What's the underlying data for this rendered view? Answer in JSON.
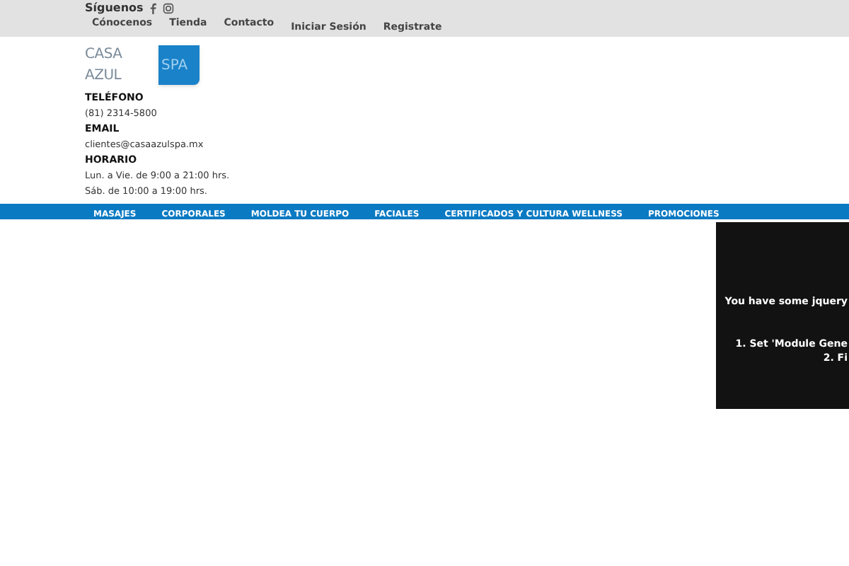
{
  "top_bar": {
    "follow_label": "Síguenos",
    "links": [
      "Cónocenos",
      "Tienda",
      "Contacto"
    ],
    "account_links": [
      "Iniciar Sesión",
      "Registrate"
    ]
  },
  "logo": {
    "name": "CASA AZUL",
    "badge": "SPA"
  },
  "contact": [
    {
      "label": "TELÉFONO",
      "lines": [
        "(81) 2314-5800"
      ]
    },
    {
      "label": "EMAIL",
      "lines": [
        "clientes@casaazulspa.mx"
      ]
    },
    {
      "label": "HORARIO",
      "lines": [
        "Lun. a Vie. de 9:00 a 21:00 hrs.",
        "Sáb. de 10:00 a 19:00 hrs."
      ]
    }
  ],
  "nav": [
    "MASAJES",
    "CORPORALES",
    "MOLDEA TU CUERPO",
    "FACIALES",
    "CERTIFICADOS Y CULTURA WELLNESS",
    "PROMOCIONES"
  ],
  "notice": {
    "heading": "You have some jquery",
    "steps": [
      "1. Set 'Module Gene",
      "2. Fi"
    ]
  }
}
